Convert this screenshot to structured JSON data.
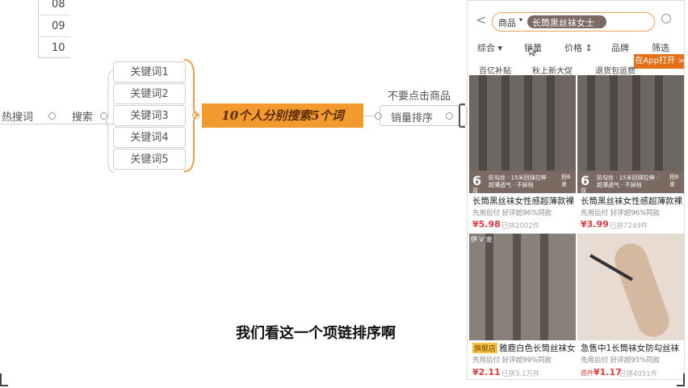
{
  "mindmap": {
    "numbers": [
      "08",
      "09",
      "10"
    ],
    "root_left": "热搜词",
    "search": "搜索",
    "keywords": [
      "关键词1",
      "关键词2",
      "关键词3",
      "关键词4",
      "关键词5"
    ],
    "center": "10个人分别搜索5个词",
    "note_top": "不要点击商品",
    "sort_node": "销量排序"
  },
  "phone": {
    "back": "<",
    "scope": "商品",
    "scope_chevron": "▾",
    "search_query": "长筒黑丝袜女士",
    "filters": [
      "综合 ▾",
      "销量",
      "价格 ↕",
      "品牌",
      "筛选"
    ],
    "tags": [
      "百亿补贴",
      "秋上新大促",
      "退货包运费"
    ],
    "app_button": "在App打开 >",
    "products": [
      {
        "banner_big": "6",
        "banner_sub": "双",
        "banner_text": "防勾丝 · 15米回弹拉伸 · 超薄透气 · 不掉档",
        "banner_right": "拍6发",
        "title": "长筒黑丝袜女性感超薄款裸",
        "meta": "先用后付  好评超96%同款",
        "price_symbol": "¥",
        "price": "5.98",
        "sold": "已拼2002件"
      },
      {
        "banner_big": "6",
        "banner_sub": "双",
        "banner_text": "防勾丝 · 15米回弹拉伸 · 超薄透气 · 不掉档",
        "banner_right": "拍6发",
        "title": "长筒黑丝袜女性感超薄款裸",
        "meta": "先用后付  好评超96%同款",
        "price_symbol": "¥",
        "price": "3.99",
        "sold": "已拼7249件"
      },
      {
        "badge": "旗舰店",
        "title": "雅鹿白色长筒丝袜女",
        "meta": "先用后付  好评超99%同款",
        "price_symbol": "¥",
        "price": "2.11",
        "sold": "已拼3.1万件",
        "corner_label": "伊 V 宠"
      },
      {
        "title": "急售中1长筒袜女防勾丝袜",
        "meta": "先用后付  好评超95%同款",
        "price_prefix": "首件",
        "price_symbol": "¥",
        "price": "1.17",
        "sold": "已拼4051件"
      }
    ]
  },
  "subtitle": "我们看这一个项链排序啊",
  "colors": {
    "accent": "#f29a2e",
    "price": "#e4393c",
    "app": "#e4701a"
  }
}
